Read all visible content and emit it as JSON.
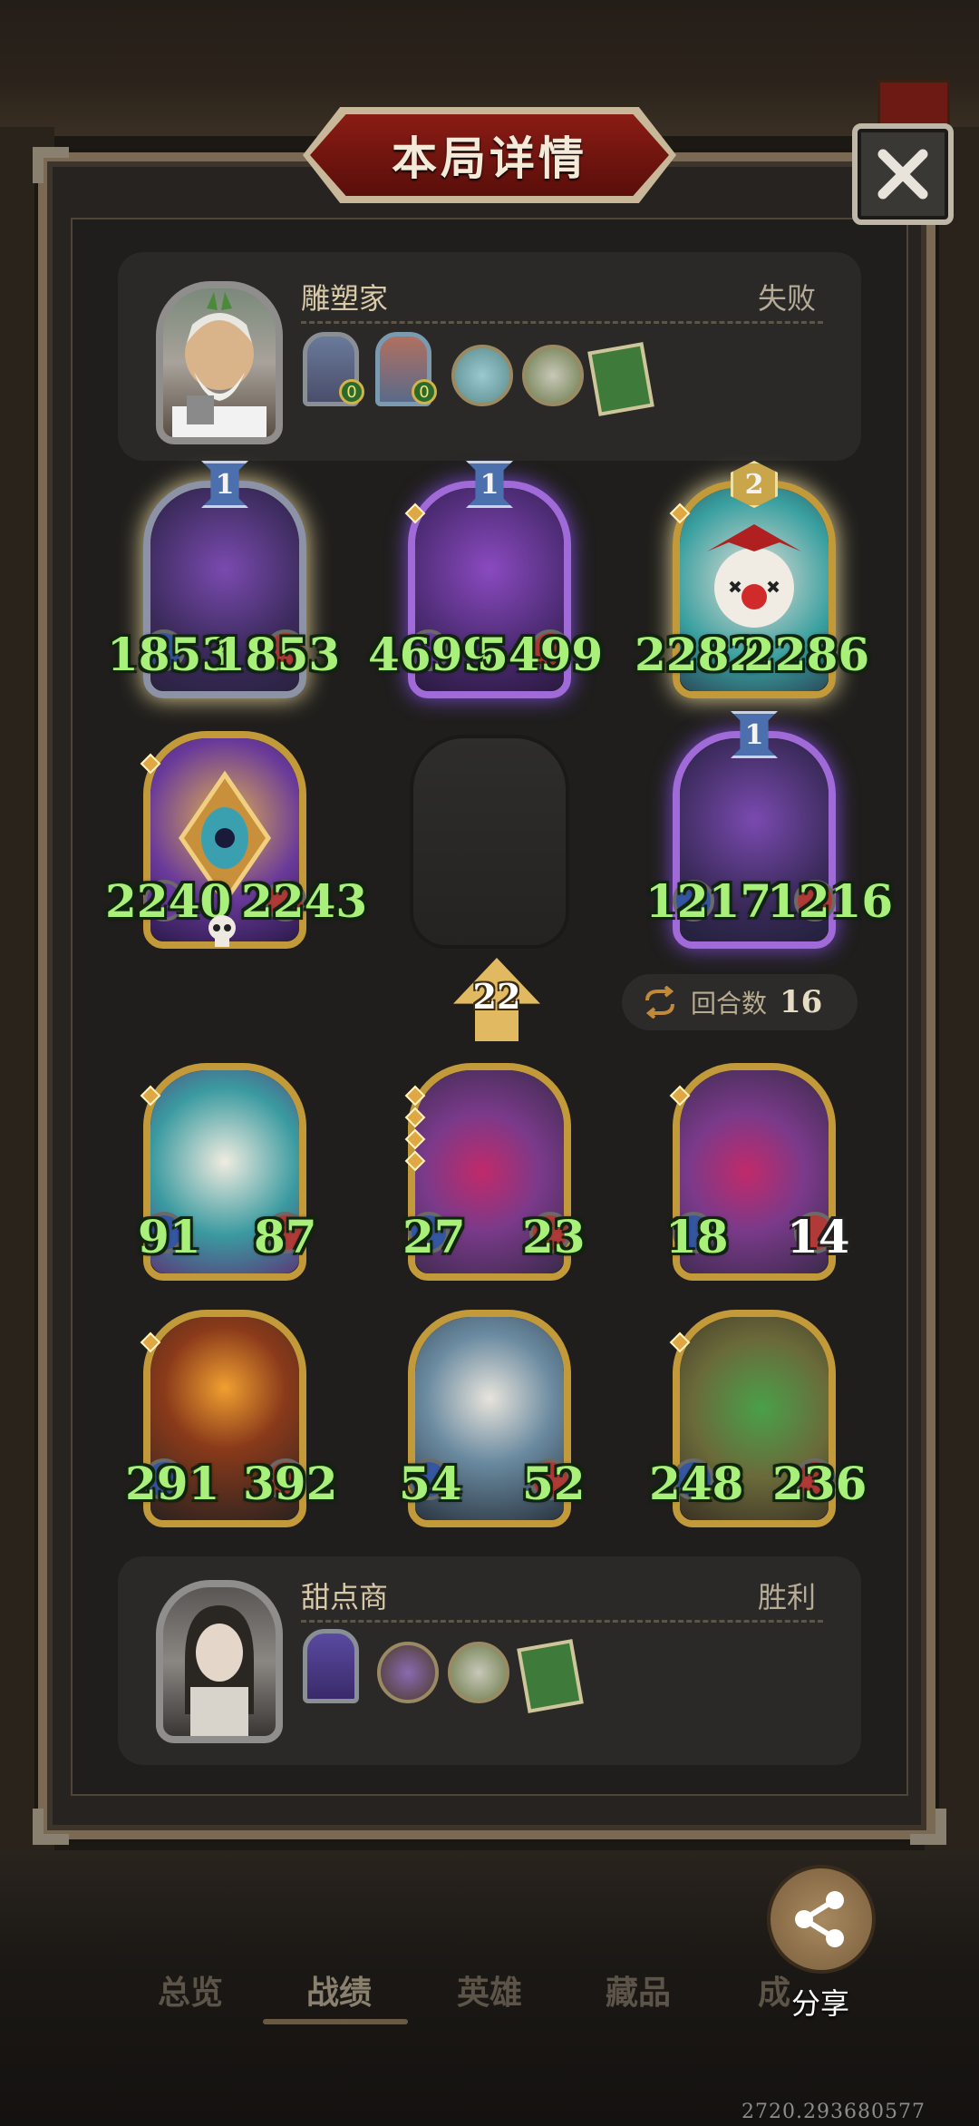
{
  "header": {
    "title": "本局详情",
    "close_icon": "close-icon"
  },
  "opponent": {
    "name": "雕塑家",
    "result": "失败",
    "minion_badges": [
      "0",
      "0"
    ]
  },
  "player": {
    "name": "甜点商",
    "result": "胜利"
  },
  "opponent_board": [
    {
      "tier": "1",
      "attack": "1853",
      "health": "1853",
      "frame": "silver"
    },
    {
      "tier": "1",
      "attack": "4699",
      "health": "5499",
      "frame": "purple"
    },
    {
      "tier": "2",
      "attack": "2282",
      "health": "2286",
      "frame": "gold"
    },
    {
      "tier": "",
      "attack": "2240",
      "health": "2243",
      "frame": "gold"
    },
    {
      "tier": "1",
      "attack": "1217",
      "health": "1216",
      "frame": "purple"
    }
  ],
  "player_board": [
    {
      "attack": "91",
      "health": "87"
    },
    {
      "attack": "27",
      "health": "23"
    },
    {
      "attack": "18",
      "health": "14"
    },
    {
      "attack": "291",
      "health": "392"
    },
    {
      "attack": "54",
      "health": "52"
    },
    {
      "attack": "248",
      "health": "236"
    }
  ],
  "tavern_tier": "22",
  "round": {
    "label": "回合数",
    "value": "16"
  },
  "nav": {
    "items": [
      "总览",
      "战绩",
      "英雄",
      "藏品",
      "成"
    ]
  },
  "share": {
    "label": "分享"
  },
  "footer_code": "2720.293680577",
  "colors": {
    "stat_green": "#a8f07a",
    "gold_frame": "#c39a3a",
    "purple_frame": "#a06ad8",
    "title_red": "#8a1c14"
  }
}
